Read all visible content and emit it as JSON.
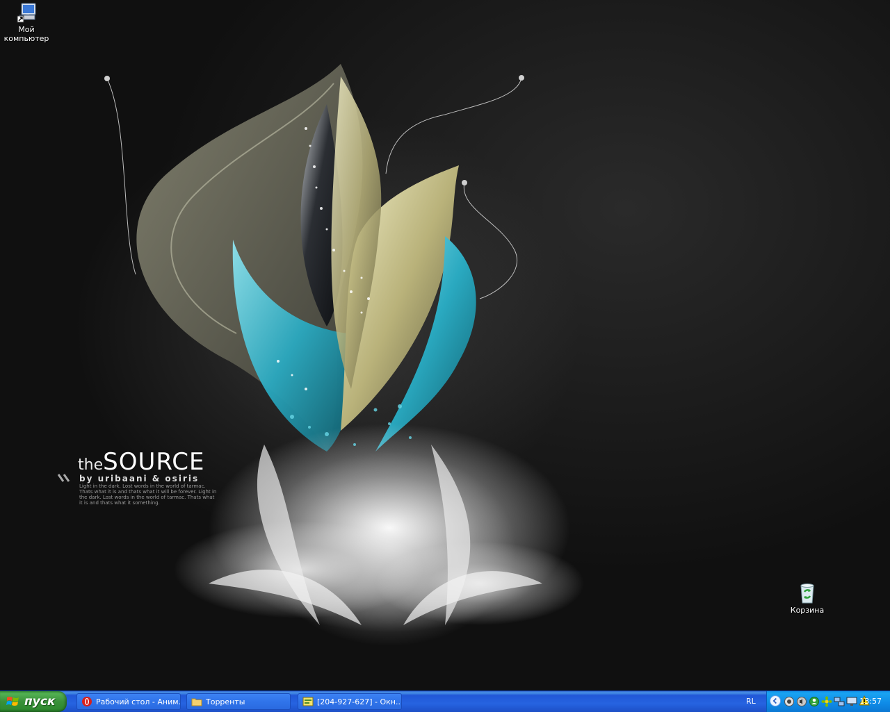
{
  "desktop": {
    "icons": [
      {
        "label_line1": "Мой",
        "label_line2": "компьютер",
        "icon": "my-computer-icon"
      },
      {
        "label_line1": "Корзина",
        "icon": "recycle-bin-icon"
      }
    ],
    "wallpaper_text": {
      "the": "the",
      "source": "SOURCE",
      "byline": "by uribaani & osiris",
      "tagline": "Light in the dark. Lost words in the world of tarmac. Thats what it is and thats what it will be forever. Light in the dark. Lost words in the world of tarmac. Thats what it is and thats what it something."
    }
  },
  "taskbar": {
    "start_label": "пуск",
    "tasks": [
      {
        "label": "Рабочий стол - Аним...",
        "icon": "opera-icon"
      },
      {
        "label": "Торренты",
        "icon": "folder-icon"
      },
      {
        "label": "[204-927-627] - Окн...",
        "icon": "chat-window-icon"
      }
    ],
    "tray": {
      "language": "RL",
      "clock": "13:57",
      "icons": [
        "expand-tray-icon",
        "network-icon",
        "sound-icon",
        "messenger-icon",
        "icq-icon",
        "network-connection-icon",
        "monitor-icon",
        "warning-icon"
      ]
    }
  },
  "colors": {
    "taskbar_blue": "#2663e0",
    "start_green": "#3a913a",
    "tray_blue": "#0f8ae6",
    "wallpaper_teal": "#2fb4c8",
    "wallpaper_gold": "#c9c48a"
  }
}
